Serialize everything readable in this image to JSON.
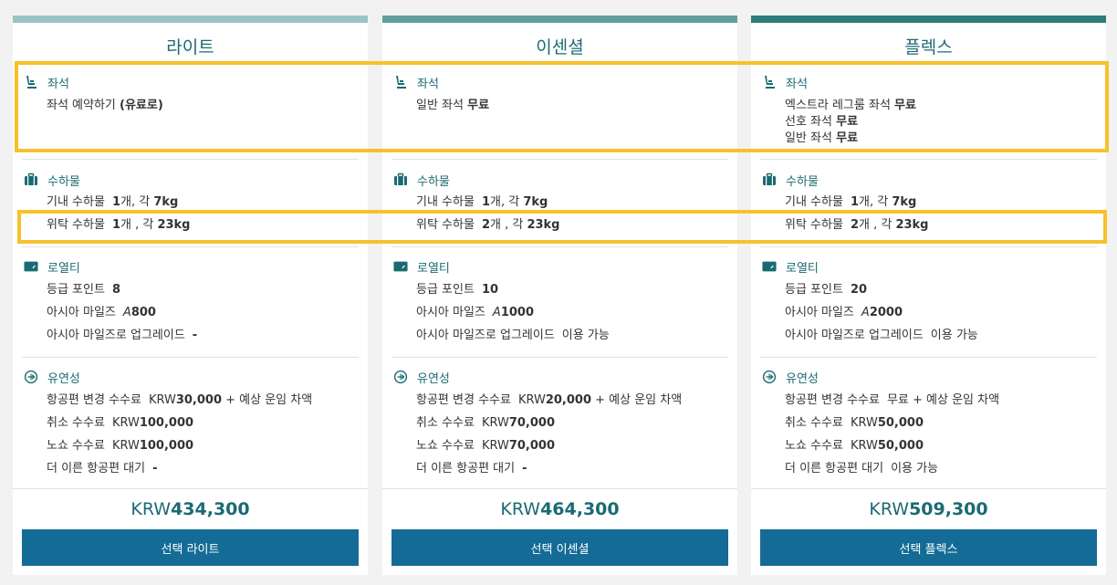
{
  "colors": {
    "lite_bar": "#9cc3c3",
    "essential_bar": "#62a0a0",
    "flex_bar": "#2d7c7c",
    "accent": "#1b6a73",
    "button": "#146c96",
    "highlight": "#f7c12b"
  },
  "sections": {
    "seat": "좌석",
    "baggage": "수하물",
    "loyalty": "로열티",
    "flexibility": "유연성"
  },
  "labels": {
    "carry_on": "기내 수하물",
    "checked": "위탁 수하물",
    "tier_points": "등급 포인트",
    "asia_miles": "아시아 마일즈",
    "upgrade": "아시아 마일즈로 업그레이드",
    "change_fee": "항공편 변경 수수료",
    "cancel_fee": "취소 수수료",
    "noshow_fee": "노쇼 수수료",
    "standby": "더 이른 항공편 대기"
  },
  "fares": [
    {
      "name": "라이트",
      "seat_lines": [
        {
          "text": "좌석 예약하기 ",
          "bold": "(유료로)"
        }
      ],
      "carry_on": {
        "count": "1",
        "unit": "개, 각 ",
        "weight": "7kg"
      },
      "checked": {
        "count": "1",
        "unit": "개 , 각 ",
        "weight": "23kg"
      },
      "tier_points": "8",
      "asia_miles_symbol": "A",
      "asia_miles": "800",
      "upgrade": "-",
      "change_fee_prefix": "KRW",
      "change_fee_amount": "30,000",
      "change_fee_suffix": " + 예상 운임 차액",
      "cancel_prefix": "KRW",
      "cancel_amount": "100,000",
      "noshow_prefix": "KRW",
      "noshow_amount": "100,000",
      "standby": "-",
      "price_prefix": "KRW",
      "price": "434,300",
      "button": "선택 라이트"
    },
    {
      "name": "이센셜",
      "seat_lines": [
        {
          "text": "일반 좌석 ",
          "bold": "무료"
        }
      ],
      "carry_on": {
        "count": "1",
        "unit": "개, 각 ",
        "weight": "7kg"
      },
      "checked": {
        "count": "2",
        "unit": "개 , 각 ",
        "weight": "23kg"
      },
      "tier_points": "10",
      "asia_miles_symbol": "A",
      "asia_miles": "1000",
      "upgrade": "이용 가능",
      "change_fee_prefix": "KRW",
      "change_fee_amount": "20,000",
      "change_fee_suffix": " + 예상 운임 차액",
      "cancel_prefix": "KRW",
      "cancel_amount": "70,000",
      "noshow_prefix": "KRW",
      "noshow_amount": "70,000",
      "standby": "-",
      "price_prefix": "KRW",
      "price": "464,300",
      "button": "선택 이센셜"
    },
    {
      "name": "플렉스",
      "seat_lines": [
        {
          "text": "엑스트라 레그룸 좌석 ",
          "bold": "무료"
        },
        {
          "text": "선호 좌석 ",
          "bold": "무료"
        },
        {
          "text": "일반 좌석 ",
          "bold": "무료"
        }
      ],
      "carry_on": {
        "count": "1",
        "unit": "개, 각 ",
        "weight": "7kg"
      },
      "checked": {
        "count": "2",
        "unit": "개 , 각 ",
        "weight": "23kg"
      },
      "tier_points": "20",
      "asia_miles_symbol": "A",
      "asia_miles": "2000",
      "upgrade": "이용 가능",
      "change_fee_prefix": "",
      "change_fee_amount": "무료",
      "change_fee_suffix": " + 예상 운임 차액",
      "cancel_prefix": "KRW",
      "cancel_amount": "50,000",
      "noshow_prefix": "KRW",
      "noshow_amount": "50,000",
      "standby": "이용 가능",
      "price_prefix": "KRW",
      "price": "509,300",
      "button": "선택 플렉스"
    }
  ]
}
